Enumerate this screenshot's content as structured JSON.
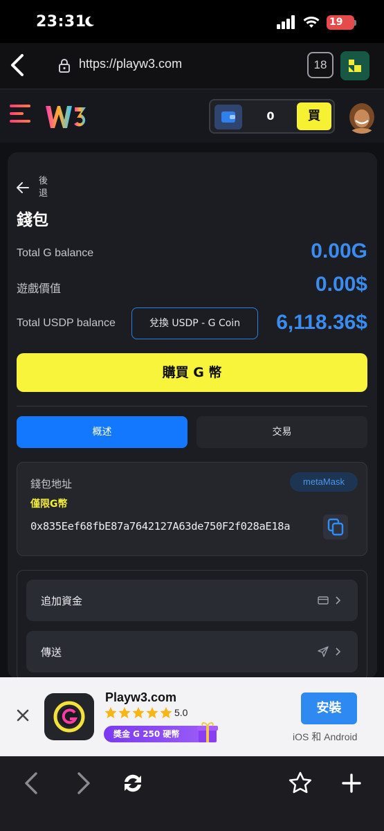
{
  "status_bar": {
    "time": "23:31",
    "battery": "19"
  },
  "browser": {
    "url": "https://playw3.com",
    "tab_count": "18"
  },
  "header": {
    "wallet_balance": "0",
    "buy_label": "買"
  },
  "wallet": {
    "back_label": "後退",
    "title": "錢包",
    "rows": [
      {
        "label": "Total G balance",
        "value": "0.00G"
      },
      {
        "label": "遊戲價值",
        "value": "0.00$"
      },
      {
        "label": "Total USDP balance",
        "value": "6,118.36$"
      }
    ],
    "exchange_label": "兌換 USDP - G Coin",
    "buy_g_label": "購買 G 幣",
    "tabs": [
      {
        "label": "概述",
        "active": true
      },
      {
        "label": "交易",
        "active": false
      }
    ],
    "address_title": "錢包地址",
    "metamask_label": "metaMask",
    "g_only_label": "僅限G幣",
    "address": "0x835Eef68fbE87a7642127A63de750F2f028aE18a",
    "actions": [
      {
        "label": "追加資金",
        "icon": "card-icon"
      },
      {
        "label": "傳送",
        "icon": "send-icon"
      }
    ]
  },
  "app_banner": {
    "name": "Playw3.com",
    "rating": "5.0",
    "promo": "獎金 G 250 硬幣",
    "install_label": "安裝",
    "platforms": "iOS 和 Android"
  },
  "colors": {
    "accent_blue": "#1478ff",
    "value_blue": "#3b8cf0",
    "accent_yellow": "#f7f43b",
    "card_bg": "#1b1d22"
  }
}
